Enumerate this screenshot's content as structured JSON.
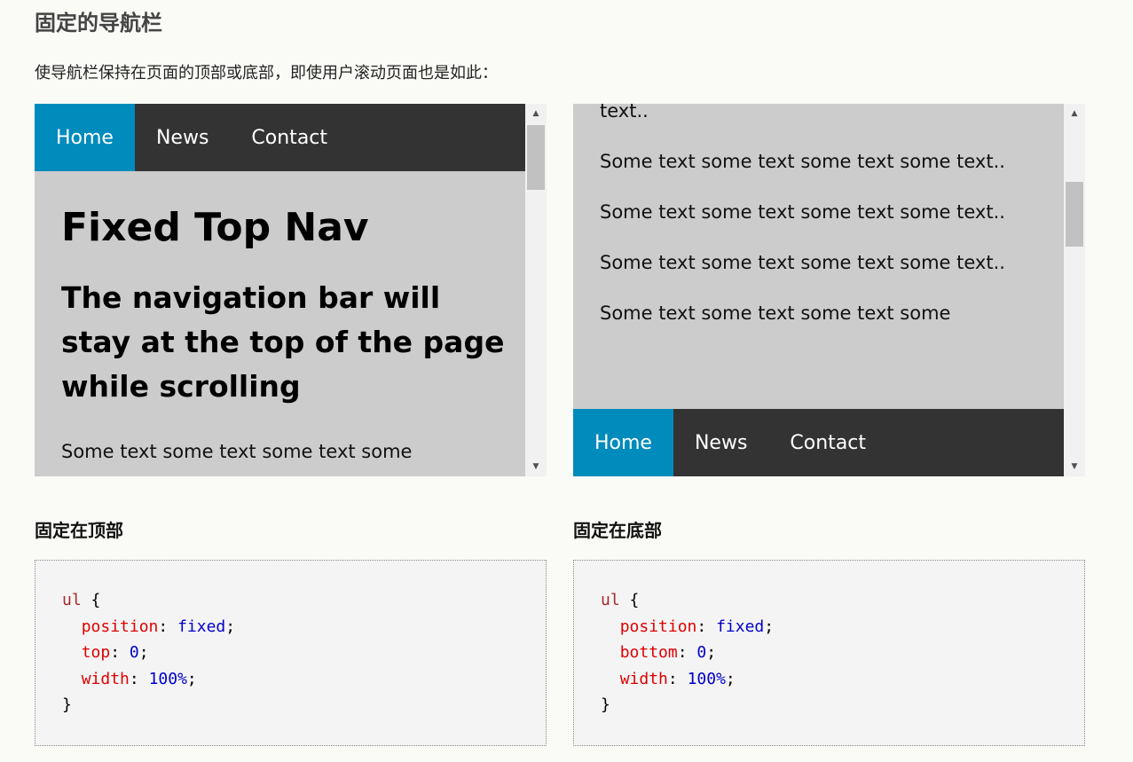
{
  "page": {
    "title": "固定的导航栏",
    "intro": "使导航栏保持在页面的顶部或底部，即使用户滚动页面也是如此："
  },
  "demo_top": {
    "nav": [
      "Home",
      "News",
      "Contact"
    ],
    "active_index": 0,
    "heading": "Fixed Top Nav",
    "subheading": "The navigation bar will stay at the top of the page while scrolling",
    "text": "Some text some text some text some"
  },
  "demo_bottom": {
    "nav": [
      "Home",
      "News",
      "Contact"
    ],
    "active_index": 0,
    "partial_top": "text..",
    "paragraphs": [
      "Some text some text some text some text..",
      "Some text some text some text some text..",
      "Some text some text some text some text..",
      "Some text some text some text some"
    ]
  },
  "sections": {
    "top_label": "固定在顶部",
    "bottom_label": "固定在底部"
  },
  "code_top": {
    "selector": "ul",
    "open": " {",
    "lines": [
      {
        "prop": "position",
        "val": "fixed"
      },
      {
        "prop": "top",
        "val": "0"
      },
      {
        "prop": "width",
        "val": "100%"
      }
    ],
    "close": "}"
  },
  "code_bottom": {
    "selector": "ul",
    "open": " {",
    "lines": [
      {
        "prop": "position",
        "val": "fixed"
      },
      {
        "prop": "bottom",
        "val": "0"
      },
      {
        "prop": "width",
        "val": "100%"
      }
    ],
    "close": "}"
  },
  "colors": {
    "nav_bg": "#333333",
    "nav_active": "#008bbd",
    "demo_bg": "#cccccc",
    "code_bg": "#f4f4f4"
  },
  "scrollbar": {
    "arrow_up": "▲",
    "arrow_down": "▼"
  }
}
